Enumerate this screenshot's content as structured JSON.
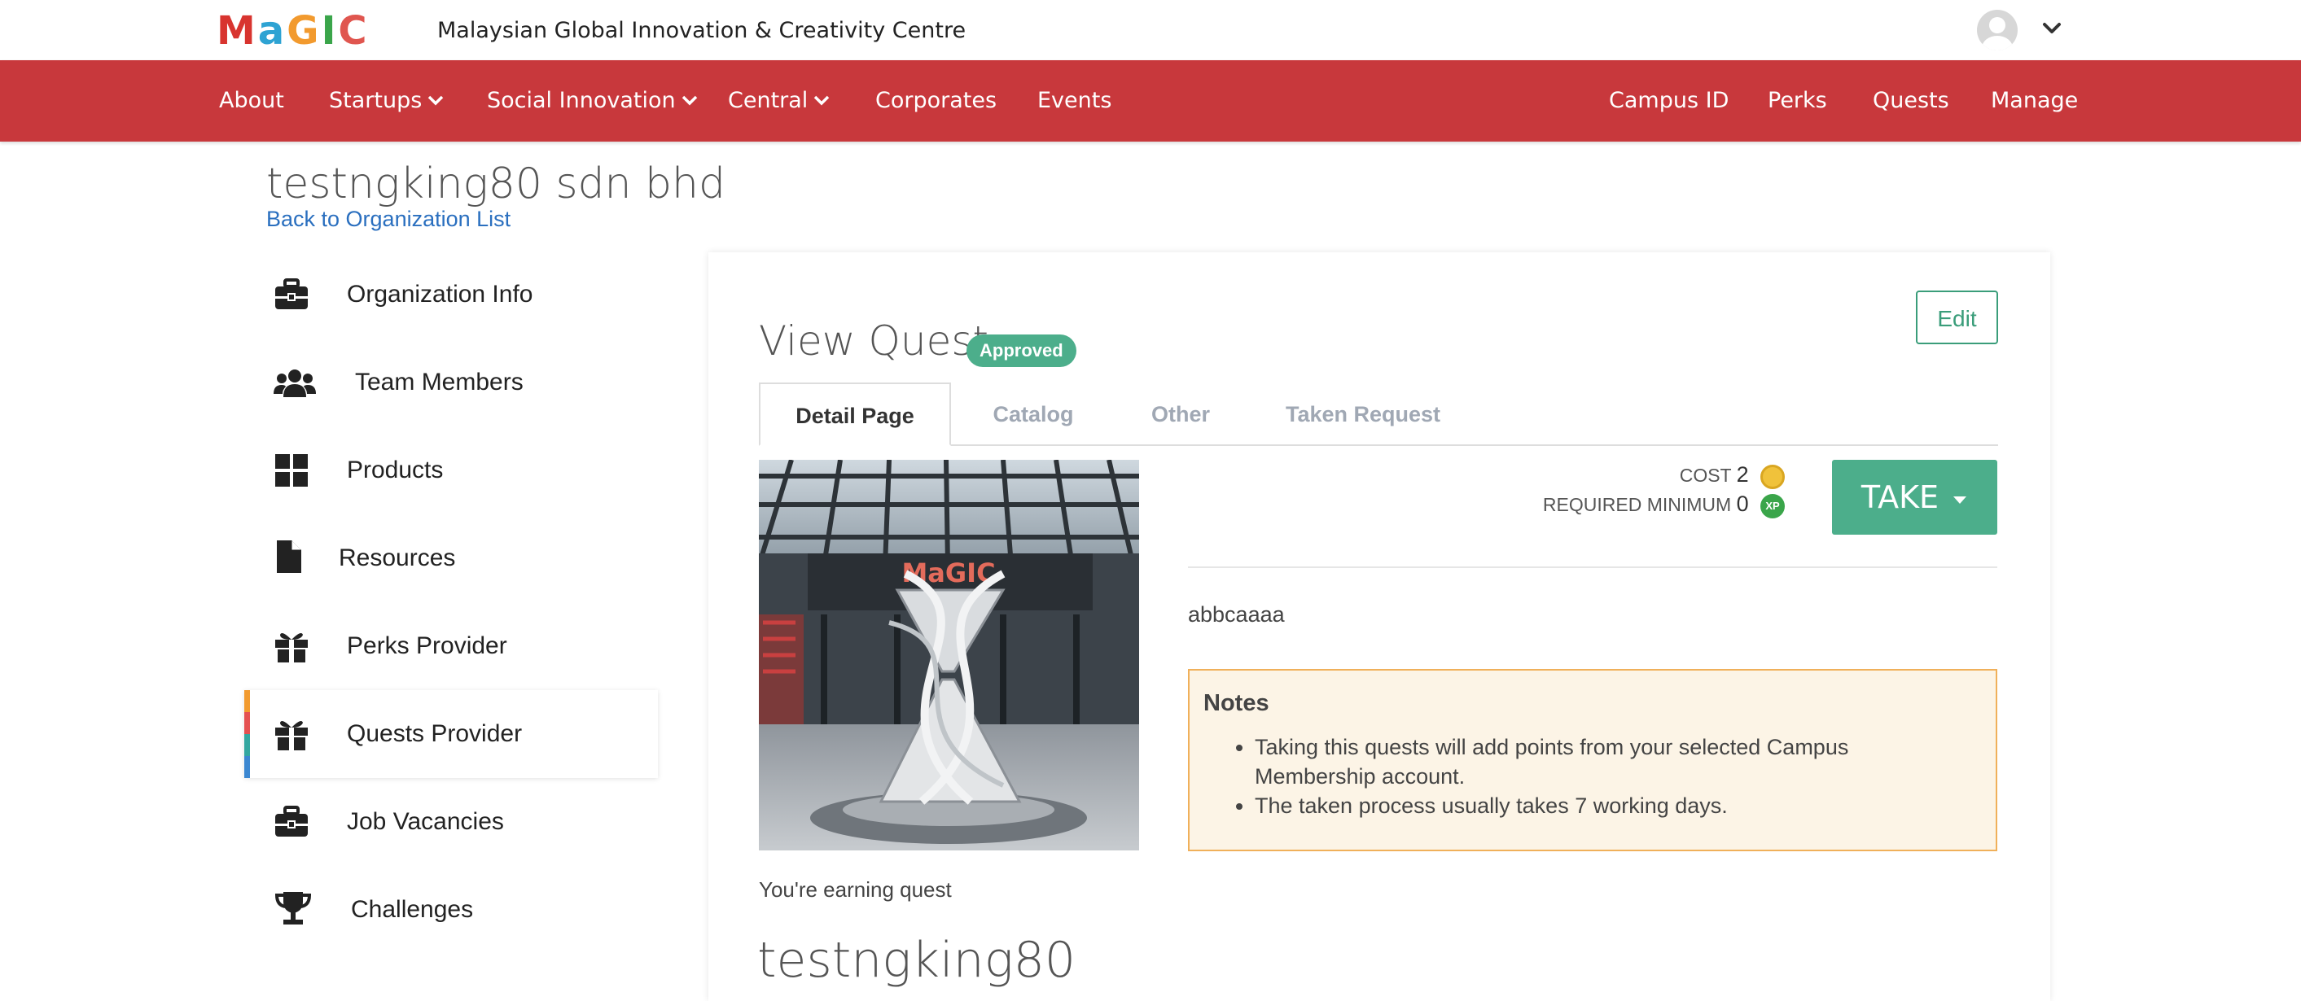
{
  "brand": {
    "logo_letters": [
      "M",
      "a",
      "G",
      "I",
      "C"
    ],
    "logo_colors": [
      "#d8342f",
      "#2ea3d3",
      "#f29a2e",
      "#3aa54a",
      "#e0564f"
    ],
    "title": "Malaysian Global Innovation & Creativity Centre"
  },
  "user_menu": {
    "avatar_icon": "user-avatar-icon",
    "caret_icon": "chevron-down-icon"
  },
  "nav": {
    "background": "#c8383c",
    "left": [
      {
        "label": "About",
        "dropdown": false
      },
      {
        "label": "Startups",
        "dropdown": true
      },
      {
        "label": "Social Innovation",
        "dropdown": true
      },
      {
        "label": "Central",
        "dropdown": true
      },
      {
        "label": "Corporates",
        "dropdown": false
      },
      {
        "label": "Events",
        "dropdown": false
      }
    ],
    "right": [
      {
        "label": "Campus ID"
      },
      {
        "label": "Perks"
      },
      {
        "label": "Quests"
      },
      {
        "label": "Manage"
      }
    ]
  },
  "page": {
    "org_title": "testngking80 sdn bhd",
    "back_link": "Back to Organization List"
  },
  "sidebar": {
    "items": [
      {
        "label": "Organization Info",
        "icon": "briefcase-icon",
        "active": false
      },
      {
        "label": "Team Members",
        "icon": "users-icon",
        "active": false
      },
      {
        "label": "Products",
        "icon": "grid-icon",
        "active": false
      },
      {
        "label": "Resources",
        "icon": "file-icon",
        "active": false
      },
      {
        "label": "Perks Provider",
        "icon": "gift-icon",
        "active": false
      },
      {
        "label": "Quests Provider",
        "icon": "gift-icon",
        "active": true
      },
      {
        "label": "Job Vacancies",
        "icon": "briefcase-icon",
        "active": false
      },
      {
        "label": "Challenges",
        "icon": "trophy-icon",
        "active": false
      }
    ]
  },
  "quest": {
    "edit_label": "Edit",
    "title": "View Quest",
    "status_badge": "Approved",
    "tabs": [
      {
        "label": "Detail Page",
        "active": true
      },
      {
        "label": "Catalog",
        "active": false
      },
      {
        "label": "Other",
        "active": false
      },
      {
        "label": "Taken Request",
        "active": false
      }
    ],
    "image_logo_text": "MaGIC",
    "cost_label": "COST",
    "cost_value": "2",
    "cost_icon": "coin-icon",
    "required_label": "REQUIRED MINIMUM",
    "required_value": "0",
    "required_icon": "xp-icon",
    "xp_glyph": "XP",
    "take_label": "TAKE",
    "description": "abbcaaaa",
    "notes_title": "Notes",
    "notes": [
      "Taking this quests will add points from your selected Campus Membership account.",
      "The taken process usually takes 7 working days."
    ],
    "earning_text": "You're earning quest",
    "bottom_title": "testngking80",
    "accent": "#4cae8b"
  }
}
